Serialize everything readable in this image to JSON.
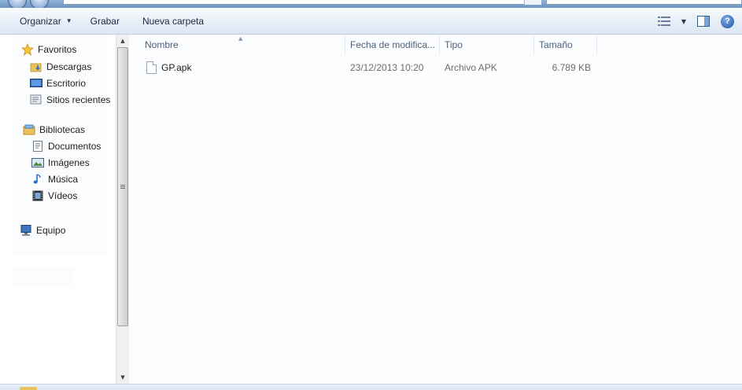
{
  "toolbar": {
    "organize": "Organizar",
    "burn": "Grabar",
    "new_folder": "Nueva carpeta"
  },
  "nav": {
    "favorites": "Favoritos",
    "downloads": "Descargas",
    "desktop": "Escritorio",
    "recent": "Sitios recientes",
    "libraries": "Bibliotecas",
    "documents": "Documentos",
    "images": "Imágenes",
    "music": "Música",
    "videos": "Vídeos",
    "computer": "Equipo"
  },
  "columns": {
    "name": "Nombre",
    "date": "Fecha de modifica...",
    "type": "Tipo",
    "size": "Tamaño"
  },
  "files": [
    {
      "name": "GP.apk",
      "date": "23/12/2013 10:20",
      "type": "Archivo APK",
      "size": "6.789 KB"
    }
  ],
  "icons": {
    "favorites": "star-icon",
    "downloads": "downloads-folder-icon",
    "desktop": "desktop-icon",
    "recent": "recent-places-icon",
    "libraries": "libraries-icon",
    "documents": "documents-icon",
    "images": "images-icon",
    "music": "music-note-icon",
    "videos": "film-icon",
    "computer": "computer-icon",
    "file": "file-icon",
    "help": "help-icon"
  },
  "colors": {
    "toolbar_text": "#1b2a44",
    "header_text": "#4c607a",
    "muted_text": "#6d6d6d",
    "help_blue": "#1d4f9e"
  }
}
